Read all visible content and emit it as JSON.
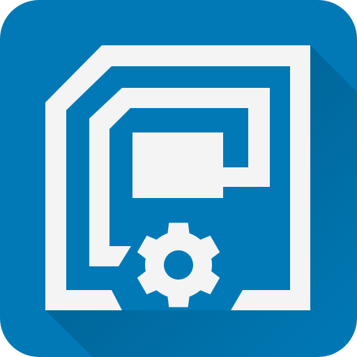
{
  "icon": {
    "name": "chip-settings-app-icon",
    "glyphs": [
      "sd-card-chip-icon",
      "gear-icon"
    ],
    "colors": {
      "background": "#0079B6",
      "long_shadow": "#00537D",
      "glyph": "#F4F4F5",
      "gear_hole": "#0079B6"
    }
  }
}
